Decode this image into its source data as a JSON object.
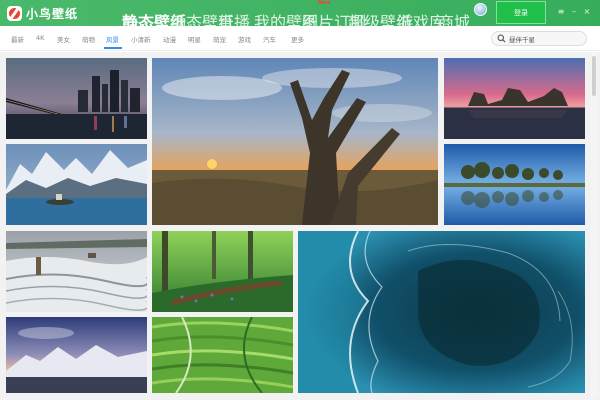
{
  "app": {
    "name": "小鸟壁纸"
  },
  "topnav": {
    "items": [
      {
        "label": "静态壁纸",
        "active": true
      },
      {
        "label": "动态壁纸",
        "active": false
      },
      {
        "label": "直播",
        "active": false
      },
      {
        "label": "我的壁纸",
        "active": false
      },
      {
        "label": "图片订制",
        "active": false
      },
      {
        "label": "超级壁纸",
        "active": false
      },
      {
        "label": "游戏库",
        "active": false
      },
      {
        "label": "商城",
        "active": false
      }
    ],
    "new_badge": "New",
    "login_label": "登录",
    "window_controls": [
      "≡",
      "–",
      "×"
    ]
  },
  "categories": {
    "items": [
      "最新",
      "4K",
      "美女",
      "萌物",
      "风景",
      "小清新",
      "动漫",
      "明星",
      "萌宠",
      "游戏",
      "汽车",
      "更多"
    ],
    "active": "风景"
  },
  "search": {
    "value": "昼伴千星"
  },
  "gallery": {
    "tiles": [
      {
        "name": "tile-city-bridge-night"
      },
      {
        "name": "tile-dead-tree-sunset"
      },
      {
        "name": "tile-pink-sky-rocks"
      },
      {
        "name": "tile-mountain-lake-island"
      },
      {
        "name": "tile-trees-reflection-lake"
      },
      {
        "name": "tile-snow-hills-house"
      },
      {
        "name": "tile-green-forest-path"
      },
      {
        "name": "tile-ocean-aerial"
      },
      {
        "name": "tile-snow-mountains-sunset"
      },
      {
        "name": "tile-green-terraces"
      }
    ]
  },
  "colors": {
    "brand_green": "#3fb663",
    "login_green": "#20c04a",
    "accent_blue": "#2f8df0"
  }
}
